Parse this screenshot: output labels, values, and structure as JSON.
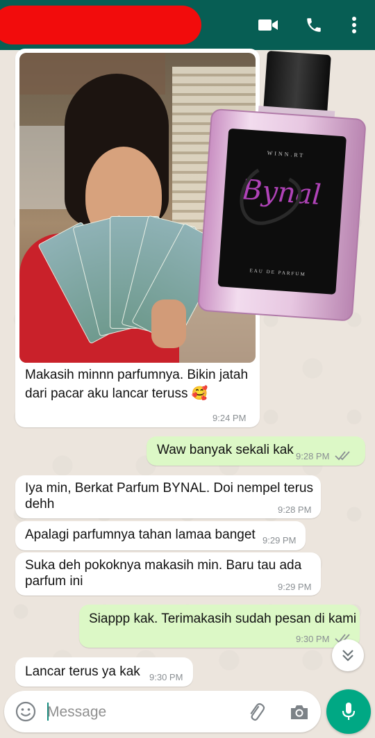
{
  "header": {
    "icons": [
      "video-call-icon",
      "phone-call-icon",
      "more-options-icon"
    ],
    "color": "#075e54"
  },
  "perfume": {
    "brand_small": "WINN.RT",
    "logo": "Bynal",
    "product_type": "EAU DE PARFUM"
  },
  "messages": [
    {
      "direction": "incoming",
      "text": "Makasih minnn parfumnya. Bikin jatah dari pacar aku lancar teruss 🥰",
      "line1": "Makasih minnn parfumnya. Bikin jatah",
      "line2": "dari pacar aku lancar teruss",
      "emoji": "🥰",
      "time": "9:24 PM"
    },
    {
      "direction": "outgoing",
      "text": "Waw banyak sekali kak",
      "time": "9:28 PM",
      "status": "read"
    },
    {
      "direction": "incoming",
      "text": "Iya min, Berkat Parfum BYNAL. Doi nempel terus dehh",
      "line1": "Iya min, Berkat Parfum BYNAL. Doi nempel terus",
      "line2": "dehh",
      "time": "9:28 PM"
    },
    {
      "direction": "incoming",
      "text": "Apalagi parfumnya tahan lamaa banget",
      "time": "9:29 PM"
    },
    {
      "direction": "incoming",
      "text": "Suka deh pokoknya makasih min. Baru tau ada parfum ini",
      "line1": "Suka deh pokoknya makasih min. Baru tau ada",
      "line2": "parfum ini",
      "time": "9:29 PM"
    },
    {
      "direction": "outgoing",
      "text": "Siappp kak. Terimakasih sudah pesan di kami",
      "time": "9:30 PM",
      "status": "read"
    },
    {
      "direction": "incoming",
      "text": "Lancar terus ya kak",
      "time": "9:30 PM"
    }
  ],
  "input": {
    "placeholder": "Message"
  },
  "colors": {
    "incoming_bubble": "#ffffff",
    "outgoing_bubble": "#dcf8c6",
    "accent": "#00a884",
    "read_ticks": "#8a8f93"
  }
}
